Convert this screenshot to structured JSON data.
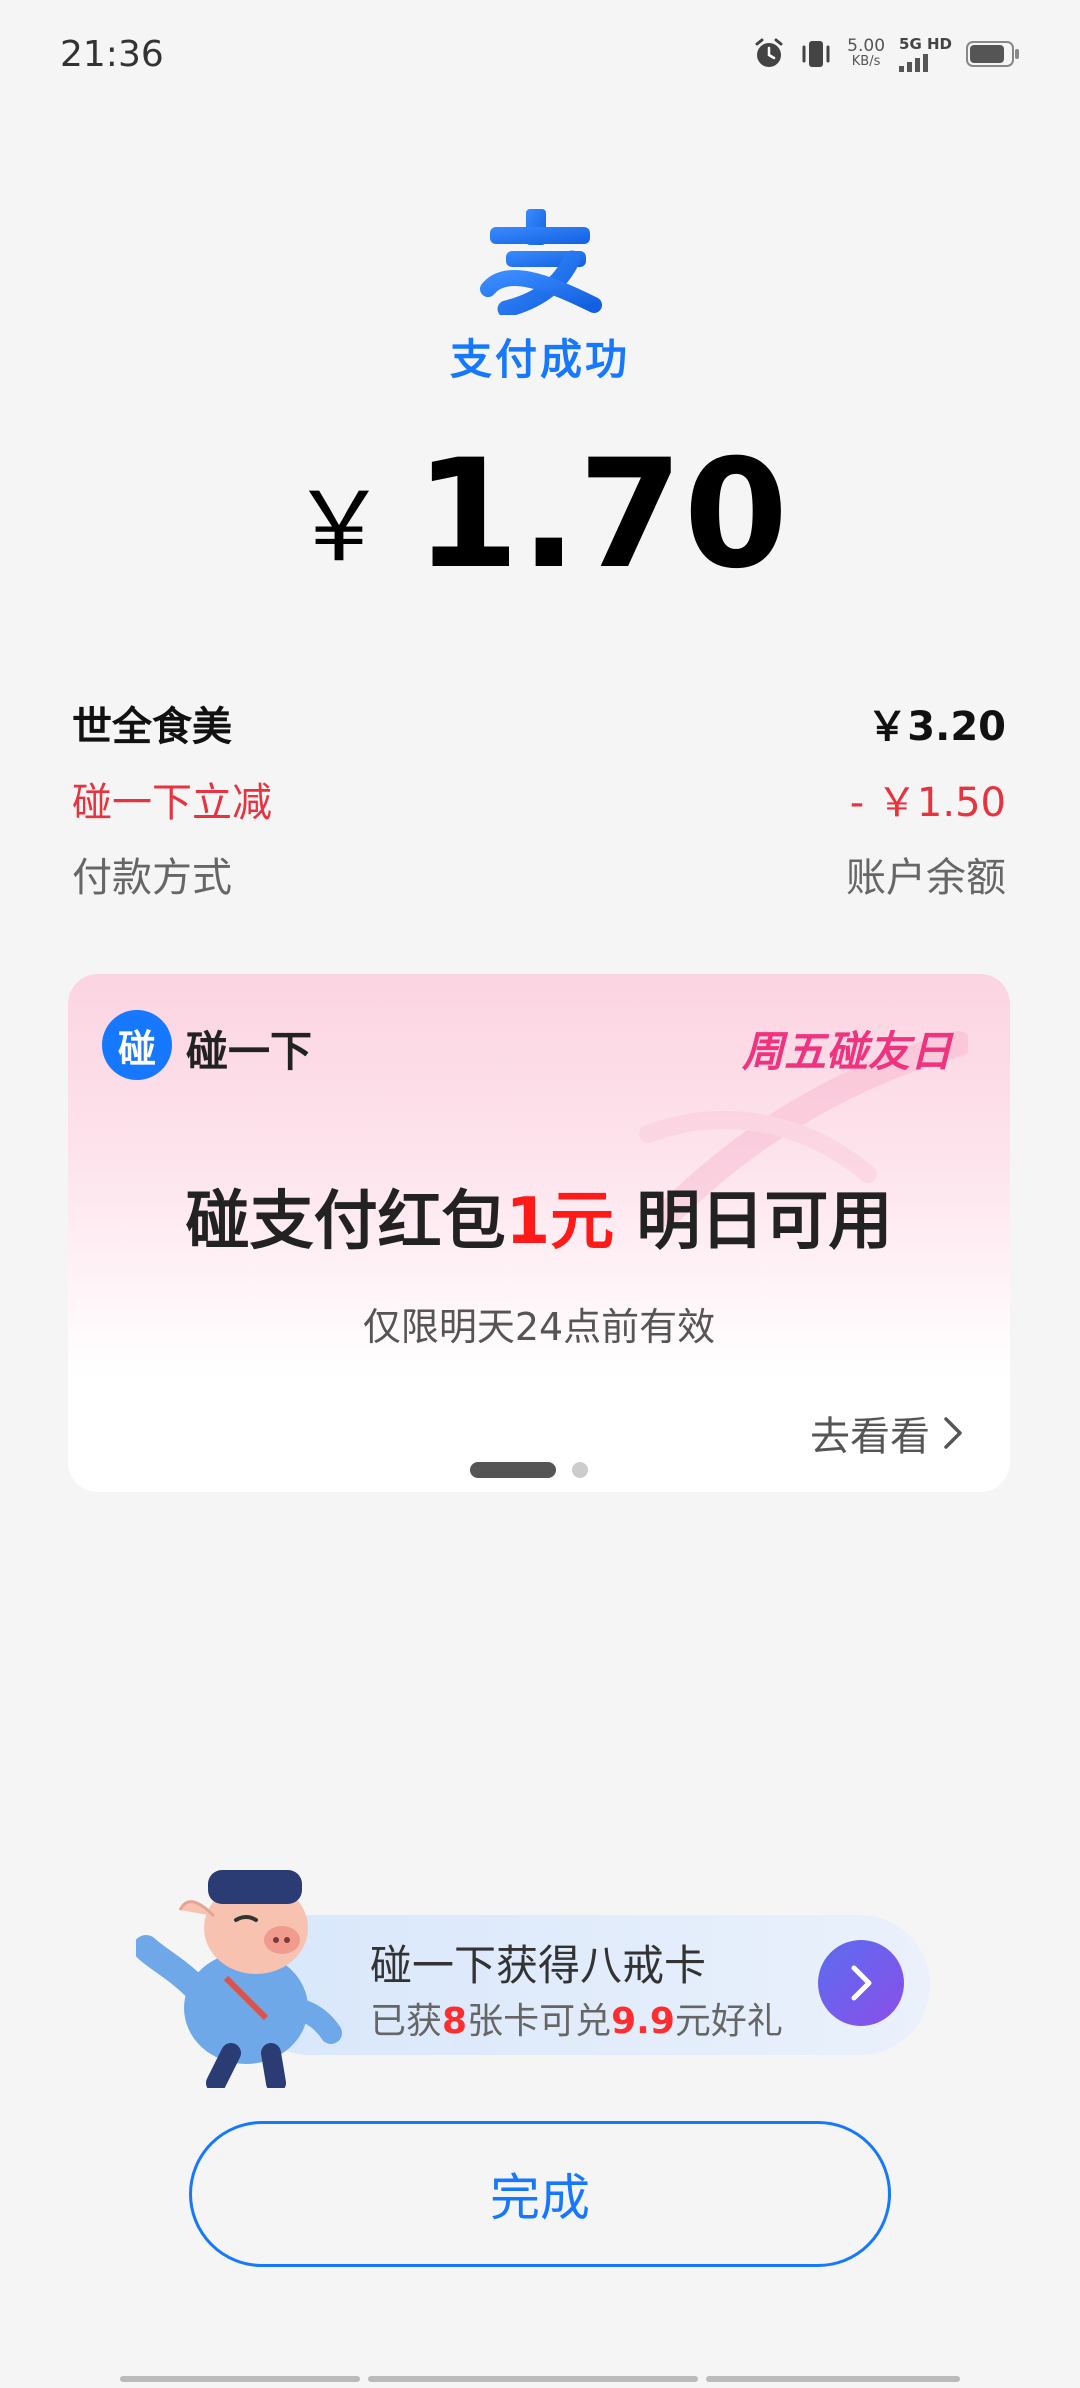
{
  "status_bar": {
    "time": "21:36",
    "net_speed_value": "5.00",
    "net_speed_unit": "KB/s",
    "network_label": "5G HD",
    "icons": [
      "alarm-icon",
      "vibrate-icon",
      "signal-icon",
      "battery-icon"
    ]
  },
  "header": {
    "logo_icon": "alipay-logo-icon",
    "status": "支付成功",
    "currency": "￥",
    "amount": "1.70"
  },
  "details": {
    "merchant_label": "世全食美",
    "merchant_value": "￥3.20",
    "discount_label": "碰一下立减",
    "discount_value": "- ￥1.50",
    "method_label": "付款方式",
    "method_value": "账户余额"
  },
  "promo": {
    "brand_icon_text": "碰",
    "brand_label": "碰一下",
    "tag": "周五碰友日",
    "headline_pre": "碰支付红包",
    "headline_highlight": "1元",
    "headline_post": " 明日可用",
    "subtitle": "仅限明天24点前有效",
    "link_label": "去看看",
    "pager_pages": 2,
    "pager_active": 1
  },
  "mascot_banner": {
    "title": "碰一下获得八戒卡",
    "sub_pre": "已获",
    "sub_count": "8",
    "sub_mid": "张卡可兑",
    "sub_value": "9.9",
    "sub_post": "元好礼"
  },
  "actions": {
    "done_label": "完成"
  },
  "colors": {
    "brand_blue": "#1677ff",
    "discount_red": "#e8333f",
    "promo_pink": "#f0337f"
  }
}
